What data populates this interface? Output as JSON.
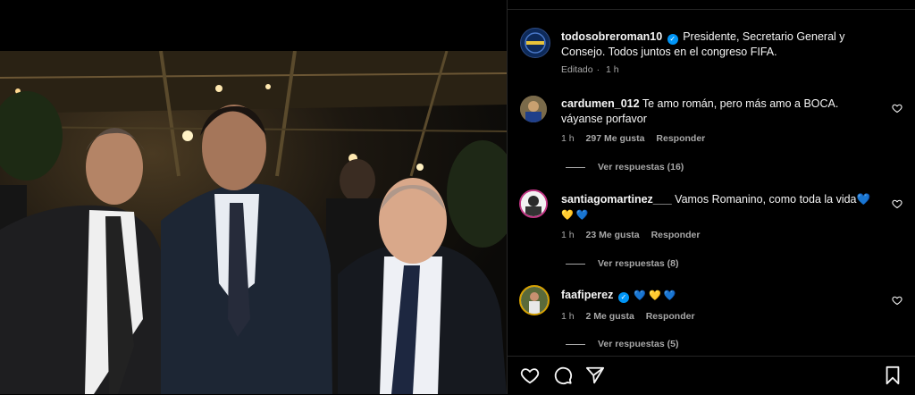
{
  "post": {
    "author": "todosobreroman10",
    "caption": "Presidente, Secretario General y Consejo. Todos juntos en el congreso FIFA.",
    "edited_label": "Editado",
    "time": "1 h"
  },
  "comments": [
    {
      "username": "cardumen_012",
      "text": "Te amo román, pero más amo a BOCA. váyanse porfavor",
      "time": "1 h",
      "likes": "297 Me gusta",
      "reply_label": "Responder",
      "view_replies": "Ver respuestas (16)"
    },
    {
      "username": "santiagomartinez___",
      "text": "Vamos Romanino, como toda la vida💙",
      "text2": "💛 💙",
      "time": "1 h",
      "likes": "23 Me gusta",
      "reply_label": "Responder",
      "view_replies": "Ver respuestas (8)"
    },
    {
      "username": "faafiperez",
      "text": "💙 💛 💙",
      "time": "1 h",
      "likes": "2 Me gusta",
      "reply_label": "Responder",
      "view_replies": "Ver respuestas (5)"
    }
  ],
  "colors": {
    "background": "#000000",
    "verified": "#0095f6",
    "secondary_text": "#a8a8a8",
    "divider": "#262626"
  },
  "icons": [
    "heart-icon",
    "comment-icon",
    "share-icon",
    "bookmark-icon",
    "verified-badge-icon"
  ]
}
